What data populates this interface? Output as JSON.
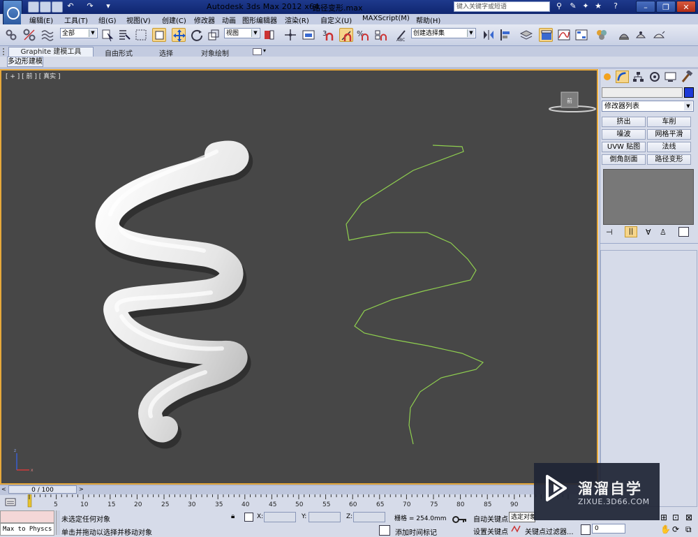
{
  "titlebar": {
    "app_title": "Autodesk 3ds Max  2012 x64",
    "file_name": "路径变形.max",
    "search_placeholder": "键入关键字或短语"
  },
  "menu": [
    "编辑(E)",
    "工具(T)",
    "组(G)",
    "视图(V)",
    "创建(C)",
    "修改器",
    "动画",
    "图形编辑器",
    "渲染(R)",
    "自定义(U)",
    "MAXScript(M)",
    "帮助(H)"
  ],
  "toolbar": {
    "selection_filter": "全部",
    "reference_coord": "视图",
    "named_selection": "创建选择集",
    "snap_label": "3"
  },
  "ribbon": {
    "tabs": [
      "Graphite 建模工具",
      "自由形式",
      "选择",
      "对象绘制"
    ],
    "subtab": "多边形建模"
  },
  "viewport": {
    "label": "[ + ] [ 前 ] [ 真实 ]",
    "viewcube_face": "前"
  },
  "command_panel": {
    "modifier_list": "修改器列表",
    "modifier_buttons": [
      "挤出",
      "车削",
      "噪波",
      "网格平滑",
      "UVW 贴图",
      "法线",
      "倒角剖面",
      "路径变形"
    ]
  },
  "timeline": {
    "frame_display": "0 / 100",
    "ticks": [
      "5",
      "10",
      "15",
      "20",
      "25",
      "30",
      "35",
      "40",
      "45",
      "50",
      "55",
      "60",
      "65",
      "70",
      "75",
      "80",
      "85",
      "90"
    ]
  },
  "status": {
    "listener_text": "Max to Physcs C",
    "message1": "未选定任何对象",
    "message2": "单击并拖动以选择并移动对象",
    "x_label": "X:",
    "y_label": "Y:",
    "z_label": "Z:",
    "grid": "栅格 = 254.0mm",
    "add_time_tag": "添加时间标记",
    "auto_key": "自动关键点",
    "selected": "选定对象",
    "set_key": "设置关键点",
    "key_filters": "关键点过滤器...",
    "frame": "0"
  },
  "watermark": {
    "title": "溜溜自学",
    "url": "ZIXUE.3D66.COM"
  },
  "colors": {
    "viewport_bg": "#474747",
    "active_border": "#e7a93b",
    "spline": "#8fcf4f",
    "titlebar": "#1e3a8c"
  }
}
